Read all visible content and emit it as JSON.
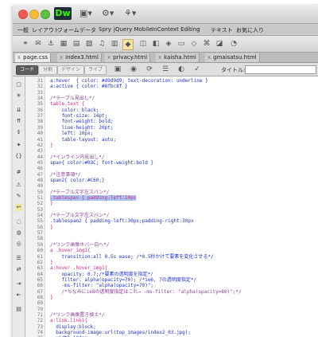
{
  "app": {
    "logo": "Dw"
  },
  "toolbar_icons": [
    "layout-icon",
    "gear-icon",
    "sync-icon"
  ],
  "menubar": {
    "items": [
      "一般",
      "レイアウト",
      "フォーム",
      "データ",
      "Spry",
      "jQuery Mobile",
      "InContext Editing",
      "テキスト",
      "お気に入り"
    ]
  },
  "tabs": [
    {
      "label": "page.css",
      "active": true
    },
    {
      "label": "index3.html",
      "active": false
    },
    {
      "label": "privacy.html",
      "active": false
    },
    {
      "label": "kaisha.html",
      "active": false
    },
    {
      "label": "gmaisatsu.html",
      "active": false
    }
  ],
  "viewbar": {
    "buttons": [
      "コード",
      "分割",
      "デザイン",
      "ライブ"
    ],
    "active_button": "コード",
    "title_label": "タイトル:"
  },
  "code_lines": [
    {
      "n": "31",
      "text": "a:hover  { color: #d9d9d9; text-decoration: underline }",
      "type": "code"
    },
    {
      "n": "32",
      "text": "a:active { color: #8fbc8f }",
      "type": "code"
    },
    {
      "n": "33",
      "text": "",
      "type": "blank"
    },
    {
      "n": "34",
      "text": "/*テーブル見出し*/",
      "type": "comment"
    },
    {
      "n": "35",
      "text": "table.text {",
      "type": "selector"
    },
    {
      "n": "36",
      "text": "    color: black;",
      "type": "prop"
    },
    {
      "n": "37",
      "text": "    font-size: 14pt;",
      "type": "prop"
    },
    {
      "n": "38",
      "text": "    font-weight: bold;",
      "type": "prop"
    },
    {
      "n": "39",
      "text": "    line-height: 20pt;",
      "type": "prop"
    },
    {
      "n": "40",
      "text": "    left: 10px;",
      "type": "prop"
    },
    {
      "n": "41",
      "text": "    table-layout: auto;",
      "type": "prop"
    },
    {
      "n": "42",
      "text": "}",
      "type": "selector"
    },
    {
      "n": "43",
      "text": "",
      "type": "blank"
    },
    {
      "n": "44",
      "text": "/*インライン内見出し*/",
      "type": "comment"
    },
    {
      "n": "45",
      "text": "span{ color:#03C; font-weight:bold }",
      "type": "code"
    },
    {
      "n": "46",
      "text": "",
      "type": "blank"
    },
    {
      "n": "47",
      "text": "/*注意事項*/",
      "type": "comment"
    },
    {
      "n": "48",
      "text": "span2{ color:#C60;}",
      "type": "code"
    },
    {
      "n": "49",
      "text": "",
      "type": "blank"
    },
    {
      "n": "50",
      "text": "/*テーブル文字左スパン*/",
      "type": "comment"
    },
    {
      "n": "51",
      "text": ".tablespan { padding-left:10px",
      "type": "highlight"
    },
    {
      "n": "52",
      "text": "}",
      "type": "selector"
    },
    {
      "n": "53",
      "text": "",
      "type": "blank"
    },
    {
      "n": "54",
      "text": "/*テーブル文字左スパン*/",
      "type": "comment"
    },
    {
      "n": "55",
      "text": ".tablespan2 { padding-left:30px;padding-right:30px",
      "type": "code"
    },
    {
      "n": "56",
      "text": "}",
      "type": "selector"
    },
    {
      "n": "57",
      "text": "",
      "type": "blank"
    },
    {
      "n": "58",
      "text": "",
      "type": "blank"
    },
    {
      "n": "59",
      "text": "/*リンク画像ホバー白へ*/",
      "type": "comment"
    },
    {
      "n": "60",
      "text": "a .hover_img1{",
      "type": "selector"
    },
    {
      "n": "61",
      "text": "    transition:all 0.5s ease; /*0.5秒かけて要素を変化させる*/",
      "type": "code"
    },
    {
      "n": "62",
      "text": "}",
      "type": "selector"
    },
    {
      "n": "63",
      "text": "a:hover .hover_img1{",
      "type": "selector"
    },
    {
      "n": "64",
      "text": "    opacity: 0.7;/*要素の透明度を指定*/",
      "type": "prop"
    },
    {
      "n": "65",
      "text": "    filter: alpha(opacity=70); /*ie6, 7の透明度指定*/",
      "type": "prop"
    },
    {
      "n": "66",
      "text": "    -ms-filter: \"alpha(opacity=70)\";",
      "type": "prop"
    },
    {
      "n": "67",
      "text": "    /*ちなみにie8の透明度指定はこれ→ -ms-filter: \"alpha(opacity=80)\";*/",
      "type": "comment"
    },
    {
      "n": "68",
      "text": "}",
      "type": "selector"
    },
    {
      "n": "69",
      "text": "",
      "type": "blank"
    },
    {
      "n": "70",
      "text": "",
      "type": "blank"
    },
    {
      "n": "71",
      "text": "/*リンク画像置き換え*/",
      "type": "comment"
    },
    {
      "n": "72",
      "text": "a:link.link1{",
      "type": "selector"
    },
    {
      "n": "73",
      "text": "  display:block;",
      "type": "prop"
    },
    {
      "n": "74",
      "text": "  background-image:url(top_images/index2_03.jpg);",
      "type": "prop"
    },
    {
      "n": "75",
      "text": "  width:104px;",
      "type": "prop"
    }
  ]
}
